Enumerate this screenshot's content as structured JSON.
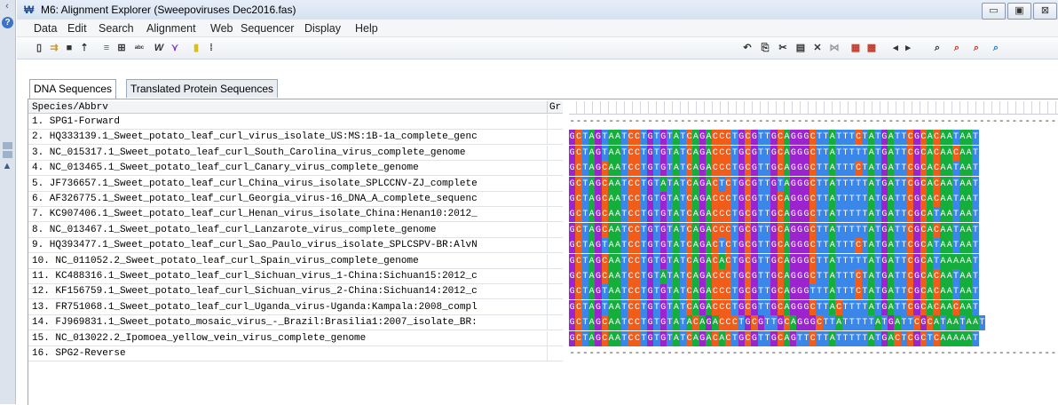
{
  "window": {
    "title": "M6: Alignment Explorer (Sweepoviruses Dec2016.fas)",
    "buttons": [
      "▭",
      "▣",
      "⊠"
    ]
  },
  "menu": [
    "Data",
    "Edit",
    "Search",
    "Alignment",
    "Web",
    "Sequencer",
    "Display",
    "Help"
  ],
  "toolbar_left": [
    "▯",
    "⇉",
    "■",
    "⇡",
    "≡",
    "⊞",
    "ᵃᵇᶜ",
    "W",
    "⋎",
    "▮",
    "⁞"
  ],
  "toolbar_right": [
    "↶",
    "⎘",
    "✂",
    "▤",
    "✕",
    "⋈",
    "▦",
    "▩",
    "◂",
    "▸",
    "⌕",
    "⌕",
    "⌕",
    "⌕"
  ],
  "left_strip": {
    "help": "?",
    "top": "‹"
  },
  "tabs": [
    "DNA Sequences",
    "Translated Protein Sequences"
  ],
  "columns": {
    "species": "Species/Abbrv",
    "group": "Gr"
  },
  "base_colors": {
    "A": "#15ad3b",
    "C": "#f05c1a",
    "G": "#9b24cf",
    "T": "#3a86e9"
  },
  "sequences": [
    {
      "name": "1. SPG1-Forward",
      "seq": "----------------------------------------------------------------------------"
    },
    {
      "name": "2. HQ333139.1_Sweet_potato_leaf_curl_virus_isolate_US:MS:1B-1a_complete_genc",
      "seq": "GCTAGTAATCCTGTGTATCAGACCCTGCGTTGCAGGGCTTATTTCTATGATTCGCACAATAAT"
    },
    {
      "name": "3. NC_015317.1_Sweet_potato_leaf_curl_South_Carolina_virus_complete_genome",
      "seq": "GCTAGTAATCCTGTGTATCAGACCCTGCGTTGCAGGGCTTATTTTTATGATTCGCACAACAAT"
    },
    {
      "name": "4. NC_013465.1_Sweet_potato_leaf_curl_Canary_virus_complete_genome",
      "seq": "GCTAGCAATCCTGTGTATCAGACCCTGCGTTGCAGGGCTTATTTCTATGATTCGCACAATAAT"
    },
    {
      "name": "5. JF736657.1_Sweet_potato_leaf_curl_China_virus_isolate_SPLCCNV-ZJ_complete",
      "seq": "GCTAGCAATCCTGTATATCAGACTCTGCGTTGTAGGGCTTATTTTTATGATTCGCACAATAAT"
    },
    {
      "name": "6. AF326775.1_Sweet_potato_leaf_curl_Georgia_virus-16_DNA_A_complete_sequenc",
      "seq": "GCTAGCAATCCTGTGTATCAGACCCTGCGTTGCAGGGCTTATTTTTATGATTCGCACAATAAT"
    },
    {
      "name": "7. KC907406.1_Sweet_potato_leaf_curl_Henan_virus_isolate_China:Henan10:2012_",
      "seq": "GCTAGCAATCCTGTGTATCAGACCCTGCGTTGCAGGGCTTATTTTTATGATTCGCATAATAAT"
    },
    {
      "name": "8. NC_013467.1_Sweet_potato_leaf_curl_Lanzarote_virus_complete_genome",
      "seq": "GCTAGCAATCCTGTGTATCAGACCCTGCGTTGCAGGGCTTATTTTTATGATTCGCACAATAAT"
    },
    {
      "name": "9. HQ393477.1_Sweet_potato_leaf_curl_Sao_Paulo_virus_isolate_SPLCSPV-BR:AlvN",
      "seq": "GCTAGTAATCCTGTGTATCAGACTCTGCGTTGCAGGGCTTATTTCTATGATTCGCATAATAAT"
    },
    {
      "name": "10. NC_011052.2_Sweet_potato_leaf_curl_Spain_virus_complete_genome",
      "seq": "GCTAGCAATCCTGTGTATCAGACACTGCGTTGCAGGGCTTATTTTTATGATTCGCATAAAAAT"
    },
    {
      "name": "11. KC488316.1_Sweet_potato_leaf_curl_Sichuan_virus_1-China:Sichuan15:2012_c",
      "seq": "GCTAGCAATCCTGTATATCAGACCCTGCGTTGCAGGGCTTATTTCTATGATTCGCACAATAAT"
    },
    {
      "name": "12. KF156759.1_Sweet_potato_leaf_curl_Sichuan_virus_2-China:Sichuan14:2012_c",
      "seq": "GCTAGTAATCCTGTGTATCAGACCCTGCGTTGCAGGGTTTATTTCTATGATTCGCACAATAAT"
    },
    {
      "name": "13. FR751068.1_Sweet_potato_leaf_curl_Uganda_virus-Uganda:Kampala:2008_compl",
      "seq": "GCTAGTAATCCTGTGTATCAGACCCTGCGTTGCAGGGCTTACTTTTATGATTCGCACAACAAT"
    },
    {
      "name": "14. FJ969831.1_Sweet_potato_mosaic_virus_-_Brazil:Brasilia1:2007_isolate_BR:",
      "seq": "GCTAGCAATCCTGTGTATACAGACCCTGCGTTGCAGGGCTTATTTTTATGATTCGCATAATAAT"
    },
    {
      "name": "15. NC_013022.2_Ipomoea_yellow_vein_virus_complete_genome",
      "seq": "GCTAGCAATCCTGTGTATCAGACACTGCGTTGCAGTTCTTATTTTTATGACTCGCTCAAAAAT"
    },
    {
      "name": "16. SPG2-Reverse",
      "seq": "----------------------------------------------------------------------------"
    }
  ]
}
